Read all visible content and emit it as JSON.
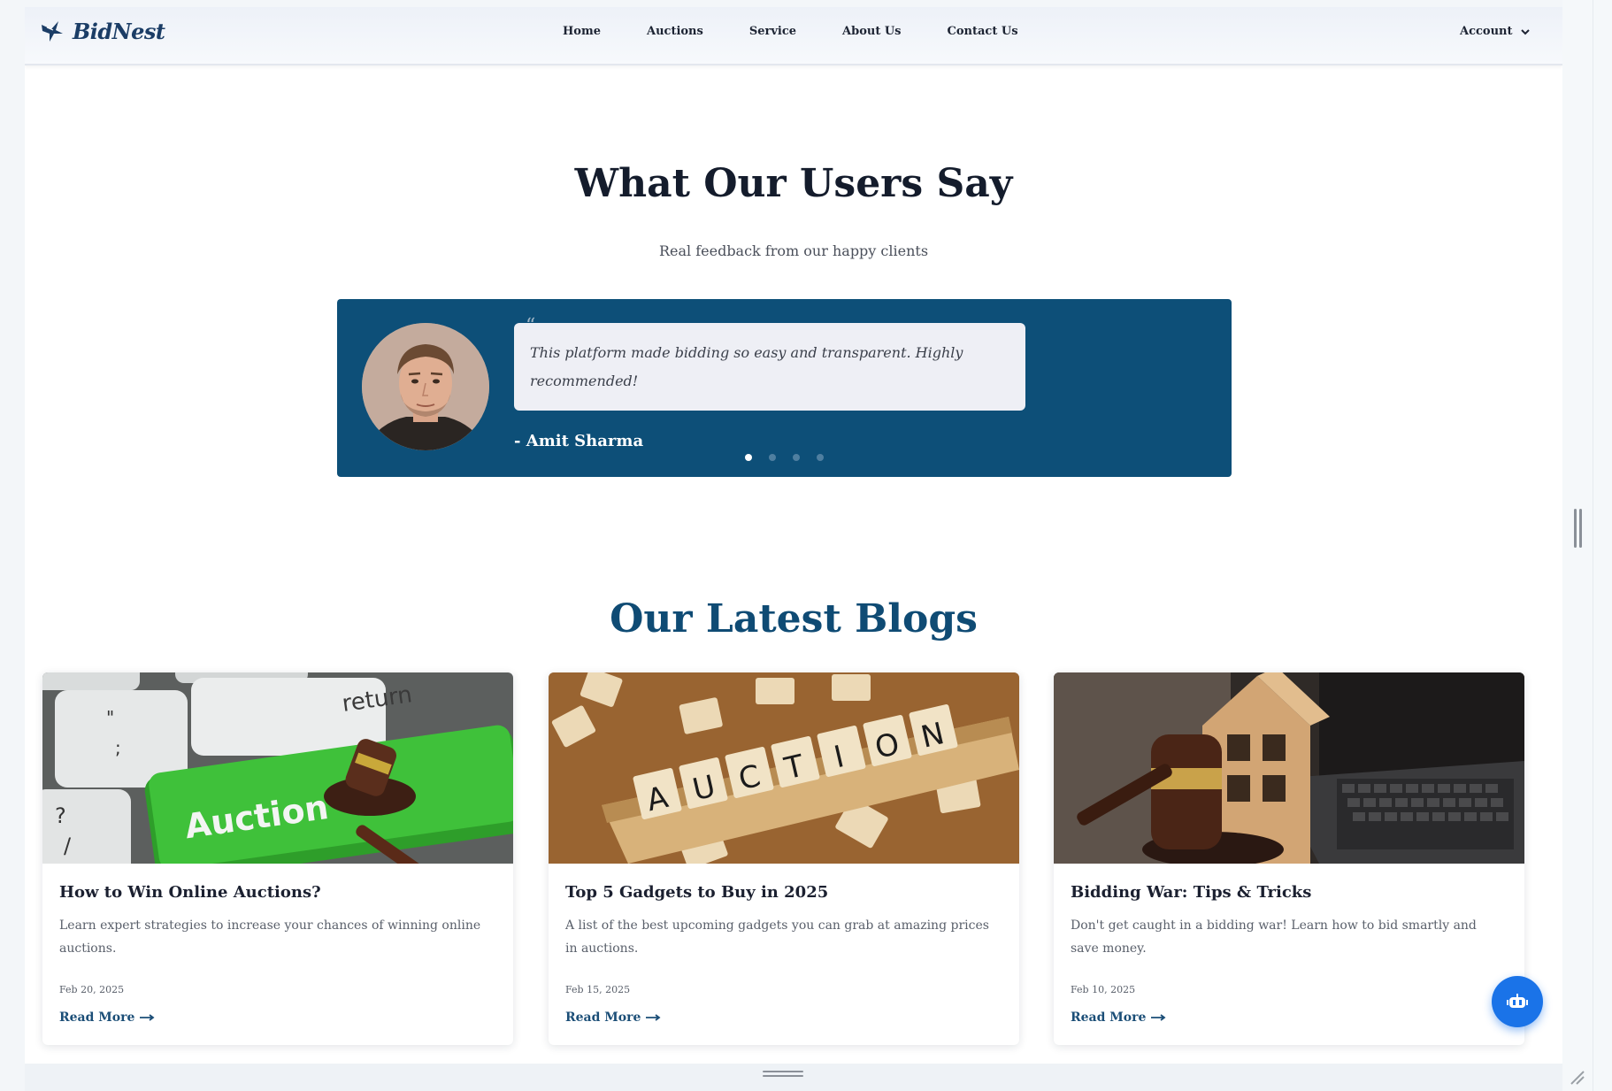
{
  "navbar": {
    "brand": "BidNest",
    "links": [
      "Home",
      "Auctions",
      "Service",
      "About Us",
      "Contact Us"
    ],
    "account": "Account"
  },
  "testimonials": {
    "title": "What Our Users Say",
    "subtitle": "Real feedback from our happy clients",
    "quote_mark": "“",
    "quote": "This platform made bidding so easy and transparent. Highly recommended!",
    "author": "- Amit Sharma",
    "slide_count": 4,
    "active_slide": 1
  },
  "blogs": {
    "title": "Our Latest Blogs",
    "cards": [
      {
        "title": "How to Win Online Auctions?",
        "description": "Learn expert strategies to increase your chances of winning online auctions.",
        "date": "Feb 20, 2025",
        "link": "Read More",
        "image": "auction-key-gavel-image"
      },
      {
        "title": "Top 5 Gadgets to Buy in 2025",
        "description": "A list of the best upcoming gadgets you can grab at amazing prices in auctions.",
        "date": "Feb 15, 2025",
        "link": "Read More",
        "image": "auction-scrabble-tiles-image"
      },
      {
        "title": "Bidding War: Tips & Tricks",
        "description": "Don't get caught in a bidding war! Learn how to bid smartly and save money.",
        "date": "Feb 10, 2025",
        "link": "Read More",
        "image": "gavel-house-laptop-image"
      }
    ]
  },
  "colors": {
    "brand": "#1b3d66",
    "testimonial_bg": "#0d4f78",
    "blog_heading": "#0f4b74",
    "fab": "#1a73e8"
  }
}
